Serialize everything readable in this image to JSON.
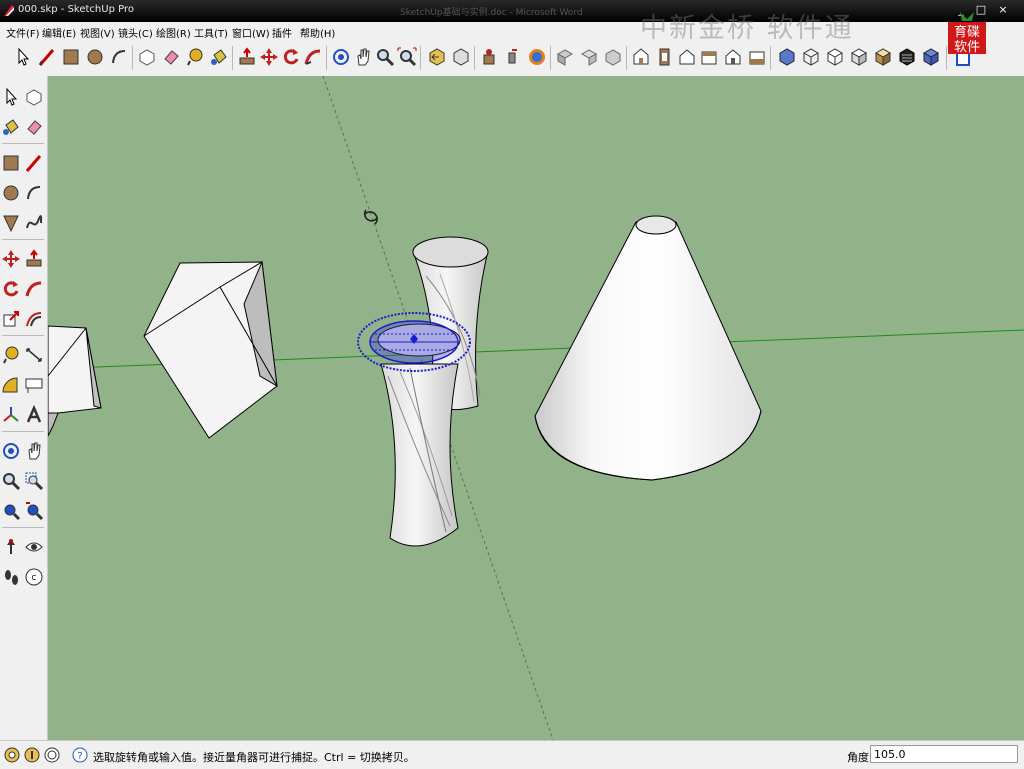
{
  "window": {
    "title": "000.skp - SketchUp Pro",
    "background_title": "SketchUp基础与实例.doc - Microsoft Word",
    "controls": {
      "minimize": "_",
      "maximize": "□",
      "close": "×"
    }
  },
  "menu": [
    "文件(F)",
    "编辑(E)",
    "视图(V)",
    "镜头(C)",
    "绘图(R)",
    "工具(T)",
    "窗口(W)",
    "插件",
    "帮助(H)"
  ],
  "watermark": "中新金桥 软件通",
  "logo": {
    "line1": "育碟",
    "line2": "软件"
  },
  "toolbar_icons": [
    "select-icon",
    "line-icon",
    "rectangle-icon",
    "circle-icon",
    "arc-icon",
    "make-component-icon",
    "eraser-icon",
    "tape-measure-icon",
    "paint-bucket-icon",
    "push-pull-icon",
    "move-icon",
    "rotate-icon",
    "follow-me-icon",
    "orbit-icon",
    "pan-icon",
    "zoom-icon",
    "zoom-extents-icon",
    "previous-view-icon",
    "next-view-icon",
    "position-camera-icon",
    "walk-icon",
    "look-around-icon",
    "section-plane-icon",
    "display-section-icon",
    "fill-section-icon",
    "iso-view-icon",
    "top-view-icon",
    "front-view-icon",
    "right-view-icon",
    "back-view-icon",
    "left-view-icon",
    "xray-style-icon",
    "wireframe-style-icon",
    "hidden-line-style-icon",
    "shaded-style-icon",
    "textured-style-icon",
    "monochrome-style-icon",
    "layers-icon"
  ],
  "sidebar_icons": [
    "select-icon",
    "make-component-icon",
    "paint-bucket-icon",
    "eraser-icon",
    "rectangle-icon",
    "line-icon",
    "circle-icon",
    "arc-icon",
    "polygon-icon",
    "freehand-icon",
    "move-icon",
    "push-pull-icon",
    "rotate-icon",
    "follow-me-icon",
    "scale-icon",
    "offset-icon",
    "tape-measure-icon",
    "dimension-icon",
    "protractor-icon",
    "text-icon",
    "axes-icon",
    "3d-text-icon",
    "orbit-icon",
    "pan-icon",
    "zoom-icon",
    "zoom-window-icon",
    "zoom-extents-icon",
    "previous-icon",
    "position-camera-icon",
    "look-around-icon",
    "walk-icon",
    "section-plane-icon"
  ],
  "statusbar": {
    "hint": "选取旋转角或输入值。接近量角器可进行捕捉。Ctrl = 切换拷贝。",
    "measure_label": "角度",
    "measure_value": "105.0"
  },
  "colors": {
    "viewport_bg": "#92b38a",
    "axis_green": "#1e8a1e",
    "axis_dashed": "#5a6e55",
    "protractor_blue": "#1c1ccc",
    "shape_face": "#f4f4f4",
    "shape_shadow": "#b8b8b8"
  }
}
